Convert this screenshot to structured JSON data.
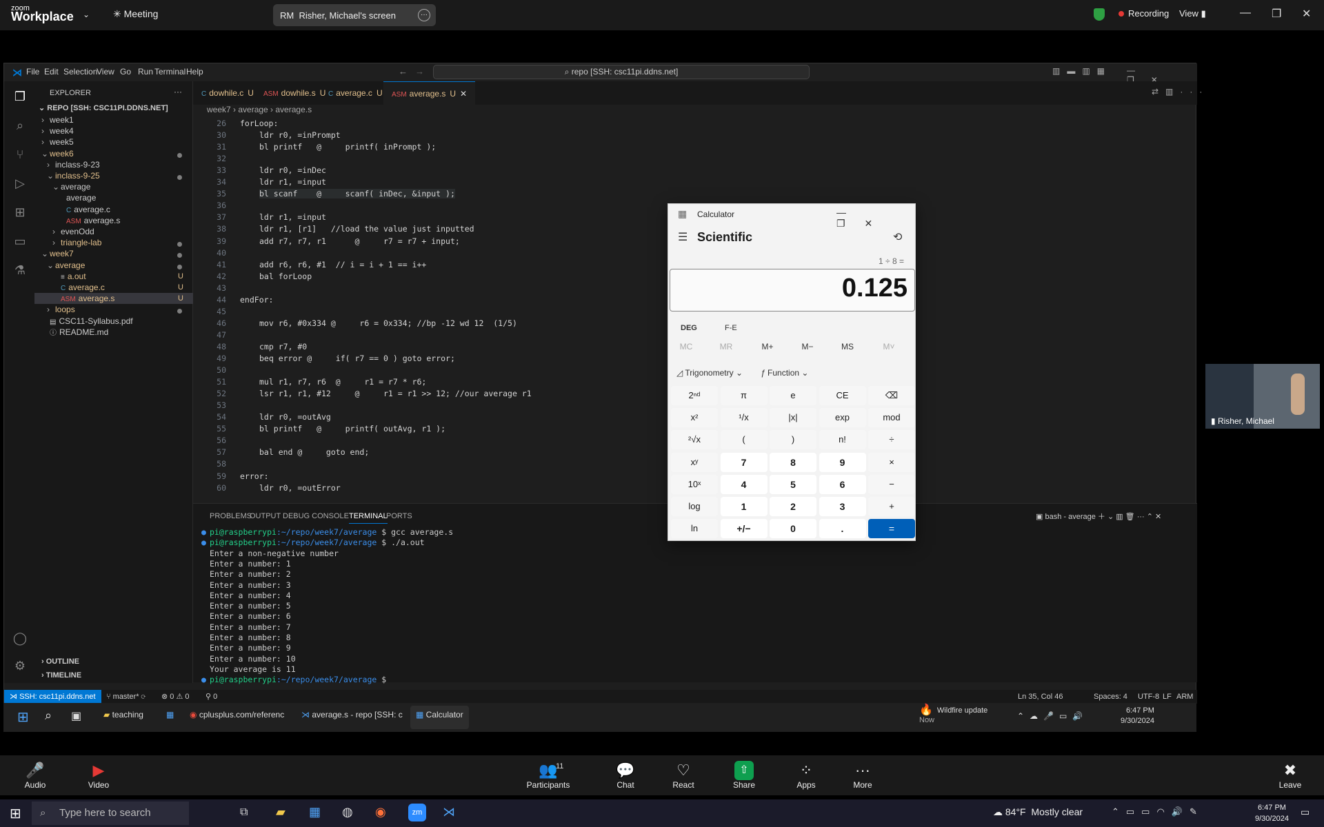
{
  "zoom": {
    "logo_top": "zoom",
    "logo_bottom": "Workplace",
    "meeting_label": "Meeting",
    "screen_initials": "RM",
    "screen_label": "Risher, Michael's screen",
    "recording_label": "Recording",
    "view_label": "View",
    "video_name": "Risher, Michael",
    "controls": [
      {
        "label": "Audio",
        "icon": "microphone-muted-icon"
      },
      {
        "label": "Video",
        "icon": "camera-off-icon"
      },
      {
        "label": "Participants",
        "icon": "participants-icon",
        "badge": "11"
      },
      {
        "label": "Chat",
        "icon": "chat-icon"
      },
      {
        "label": "React",
        "icon": "heart-icon"
      },
      {
        "label": "Share",
        "icon": "share-icon"
      },
      {
        "label": "Apps",
        "icon": "apps-icon"
      },
      {
        "label": "More",
        "icon": "more-icon"
      },
      {
        "label": "Leave",
        "icon": "leave-icon"
      }
    ]
  },
  "vscode": {
    "menu": [
      "File",
      "Edit",
      "Selection",
      "View",
      "Go",
      "Run",
      "Terminal",
      "Help"
    ],
    "search": "repo [SSH: csc11pi.ddns.net]",
    "explorer_title": "EXPLORER",
    "repo_title": "REPO [SSH: CSC11PI.DDNS.NET]",
    "tree": [
      {
        "label": "week1",
        "indent": 0,
        "arrow": "›"
      },
      {
        "label": "week4",
        "indent": 0,
        "arrow": "›"
      },
      {
        "label": "week5",
        "indent": 0,
        "arrow": "›"
      },
      {
        "label": "week6",
        "indent": 0,
        "arrow": "⌄",
        "color": "#e2c08d",
        "dot": true
      },
      {
        "label": "inclass-9-23",
        "indent": 1,
        "arrow": "›"
      },
      {
        "label": "inclass-9-25",
        "indent": 1,
        "arrow": "⌄",
        "color": "#e2c08d",
        "dot": true
      },
      {
        "label": "average",
        "indent": 2,
        "arrow": "⌄"
      },
      {
        "label": "average",
        "indent": 3,
        "arrow": ""
      },
      {
        "label": "average.c",
        "indent": 3,
        "arrow": "",
        "icon": "C"
      },
      {
        "label": "average.s",
        "indent": 3,
        "arrow": "",
        "icon": "asm"
      },
      {
        "label": "evenOdd",
        "indent": 2,
        "arrow": "›"
      },
      {
        "label": "triangle-lab",
        "indent": 2,
        "arrow": "›",
        "color": "#e2c08d",
        "dot": true
      },
      {
        "label": "week7",
        "indent": 0,
        "arrow": "⌄",
        "color": "#e2c08d",
        "dot": true
      },
      {
        "label": "average",
        "indent": 1,
        "arrow": "⌄",
        "color": "#e2c08d",
        "dot": true
      },
      {
        "label": "a.out",
        "indent": 2,
        "arrow": "",
        "color": "#e2c08d",
        "u": "U",
        "icon": "≡"
      },
      {
        "label": "average.c",
        "indent": 2,
        "arrow": "",
        "color": "#e2c08d",
        "u": "U",
        "icon": "C"
      },
      {
        "label": "average.s",
        "indent": 2,
        "arrow": "",
        "color": "#e2c08d",
        "u": "U",
        "icon": "asm",
        "selected": true
      },
      {
        "label": "loops",
        "indent": 1,
        "arrow": "›",
        "color": "#e2c08d",
        "dot": true
      },
      {
        "label": "CSC11-Syllabus.pdf",
        "indent": 0,
        "arrow": "",
        "icon": "pdf"
      },
      {
        "label": "README.md",
        "indent": 0,
        "arrow": "",
        "icon": "ⓘ"
      }
    ],
    "outline": "OUTLINE",
    "timeline": "TIMELINE",
    "tabs": [
      {
        "label": "dowhile.c",
        "u": "U",
        "icon": "C"
      },
      {
        "label": "dowhile.s",
        "u": "U",
        "icon": "asm"
      },
      {
        "label": "average.c",
        "u": "U",
        "icon": "C"
      },
      {
        "label": "average.s",
        "u": "U",
        "icon": "asm",
        "active": true
      }
    ],
    "breadcrumb": "week7 › average › average.s",
    "code_lines": [
      {
        "n": "26",
        "t": "forLoop:",
        "cls": "lbl",
        "x": 0
      },
      {
        "n": "30",
        "t": "ldr r0, =inPrompt"
      },
      {
        "n": "31",
        "t": "bl printf   @     printf( inPrompt );"
      },
      {
        "n": "32",
        "t": ""
      },
      {
        "n": "33",
        "t": "ldr r0, =inDec"
      },
      {
        "n": "34",
        "t": "ldr r1, =input"
      },
      {
        "n": "35",
        "t": "bl scanf    @     scanf( inDec, &input );"
      },
      {
        "n": "36",
        "t": ""
      },
      {
        "n": "37",
        "t": "ldr r1, =input"
      },
      {
        "n": "38",
        "t": "ldr r1, [r1]   //load the value just inputted"
      },
      {
        "n": "39",
        "t": "add r7, r7, r1      @     r7 = r7 + input;"
      },
      {
        "n": "40",
        "t": ""
      },
      {
        "n": "41",
        "t": "add r6, r6, #1  // i = i + 1 == i++"
      },
      {
        "n": "42",
        "t": "bal forLoop"
      },
      {
        "n": "43",
        "t": ""
      },
      {
        "n": "44",
        "t": "endFor:",
        "x": 0
      },
      {
        "n": "45",
        "t": ""
      },
      {
        "n": "46",
        "t": "mov r6, #0x334 @     r6 = 0x334; //bp -12 wd 12  (1/5)"
      },
      {
        "n": "47",
        "t": ""
      },
      {
        "n": "48",
        "t": "cmp r7, #0"
      },
      {
        "n": "49",
        "t": "beq error @     if( r7 == 0 ) goto error;"
      },
      {
        "n": "50",
        "t": ""
      },
      {
        "n": "51",
        "t": "mul r1, r7, r6  @     r1 = r7 * r6;"
      },
      {
        "n": "52",
        "t": "lsr r1, r1, #12     @     r1 = r1 >> 12; //our average r1"
      },
      {
        "n": "53",
        "t": ""
      },
      {
        "n": "54",
        "t": "ldr r0, =outAvg"
      },
      {
        "n": "55",
        "t": "bl printf   @     printf( outAvg, r1 );"
      },
      {
        "n": "56",
        "t": ""
      },
      {
        "n": "57",
        "t": "bal end @     goto end;"
      },
      {
        "n": "58",
        "t": ""
      },
      {
        "n": "59",
        "t": "error:",
        "x": 0
      },
      {
        "n": "60",
        "t": "ldr r0, =outError"
      }
    ],
    "panel_tabs": [
      "PROBLEMS",
      "OUTPUT",
      "DEBUG CONSOLE",
      "TERMINAL",
      "PORTS"
    ],
    "terminal_name": "bash - average",
    "terminal_lines": [
      {
        "prompt": "pi@raspberrypi",
        "path": ":~/repo/week7/average",
        "cmd": " $ gcc average.s"
      },
      {
        "prompt": "pi@raspberrypi",
        "path": ":~/repo/week7/average",
        "cmd": " $ ./a.out"
      },
      {
        "out": "Enter a non-negative number"
      },
      {
        "out": "Enter a number: 1"
      },
      {
        "out": "Enter a number: 2"
      },
      {
        "out": "Enter a number: 3"
      },
      {
        "out": "Enter a number: 4"
      },
      {
        "out": "Enter a number: 5"
      },
      {
        "out": "Enter a number: 6"
      },
      {
        "out": "Enter a number: 7"
      },
      {
        "out": "Enter a number: 8"
      },
      {
        "out": "Enter a number: 9"
      },
      {
        "out": "Enter a number: 10"
      },
      {
        "out": "Your average is 11"
      },
      {
        "prompt": "pi@raspberrypi",
        "path": ":~/repo/week7/average",
        "cmd": " $ "
      }
    ],
    "status": {
      "remote": "SSH: csc11pi.ddns.net",
      "branch": "master*",
      "problems": "⊗ 0 ⚠ 0",
      "ports": "0",
      "position": "Ln 35, Col 46",
      "spaces": "Spaces: 4",
      "encoding": "UTF-8",
      "eol": "LF",
      "lang": "ARM"
    }
  },
  "calculator": {
    "title": "Calculator",
    "mode": "Scientific",
    "expression": "1 ÷ 8 =",
    "display": "0.125",
    "angle": "DEG",
    "fe": "F-E",
    "memory": [
      "MC",
      "MR",
      "M+",
      "M−",
      "MS",
      "M˅"
    ],
    "trig_label": "Trigonometry",
    "func_label": "Function",
    "buttons": [
      [
        "2ⁿᵈ",
        "π",
        "e",
        "CE",
        "⌫"
      ],
      [
        "x²",
        "¹/x",
        "|x|",
        "exp",
        "mod"
      ],
      [
        "²√x",
        "(",
        ")",
        "n!",
        "÷"
      ],
      [
        "xʸ",
        "7",
        "8",
        "9",
        "×"
      ],
      [
        "10ˣ",
        "4",
        "5",
        "6",
        "−"
      ],
      [
        "log",
        "1",
        "2",
        "3",
        "+"
      ],
      [
        "ln",
        "+/−",
        "0",
        ".",
        "="
      ]
    ]
  },
  "inner_taskbar": {
    "items": [
      "teaching",
      "cplusplus.com/referenc",
      "average.s - repo [SSH: c",
      "Calculator"
    ],
    "weather_title": "Wildfire update",
    "weather_sub": "Now",
    "time": "6:47 PM",
    "date": "9/30/2024"
  },
  "windows_taskbar": {
    "search": "Type here to search",
    "temp": "84°F",
    "weather": "Mostly clear",
    "time": "6:47 PM",
    "date": "9/30/2024"
  }
}
